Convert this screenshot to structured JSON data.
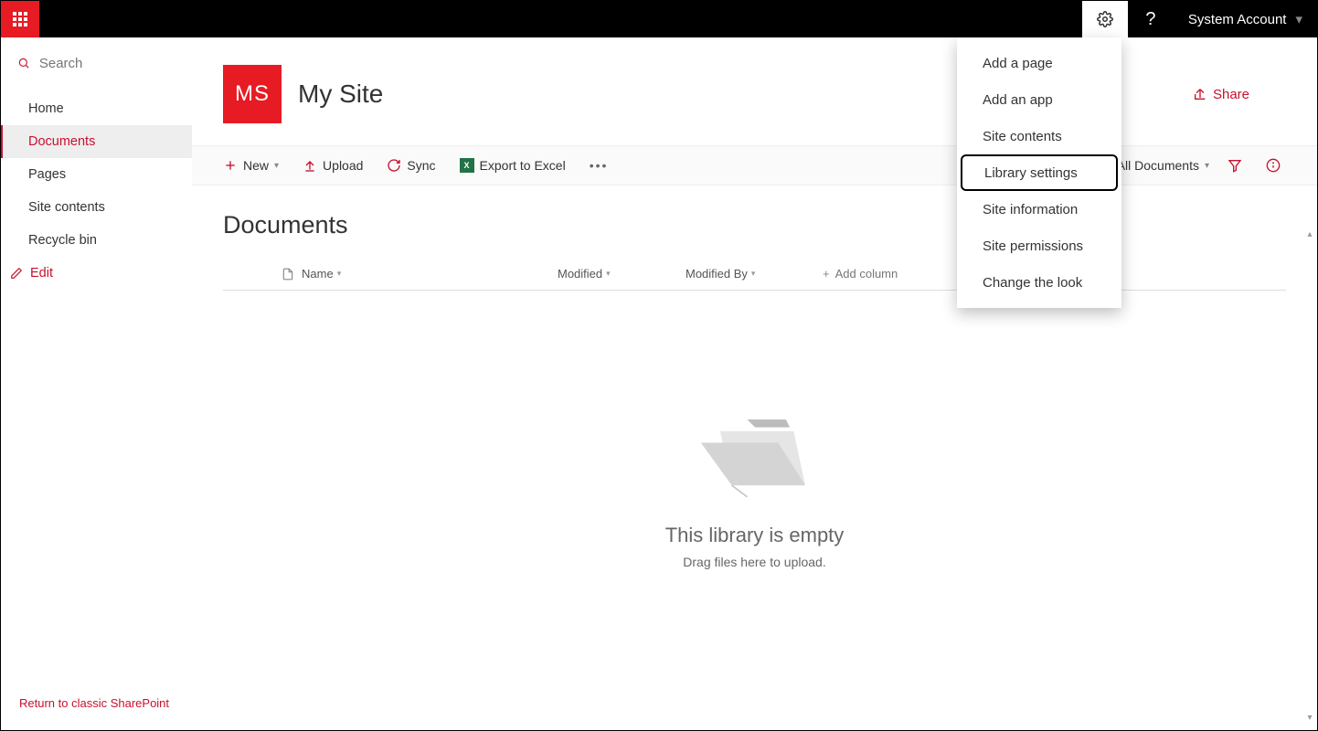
{
  "topbar": {
    "user_label": "System Account"
  },
  "sidebar": {
    "search_placeholder": "Search",
    "items": [
      {
        "label": "Home"
      },
      {
        "label": "Documents"
      },
      {
        "label": "Pages"
      },
      {
        "label": "Site contents"
      },
      {
        "label": "Recycle bin"
      }
    ],
    "edit_label": "Edit",
    "classic_link": "Return to classic SharePoint"
  },
  "site": {
    "logo_text": "MS",
    "title": "My Site",
    "share_label": "Share"
  },
  "commandbar": {
    "new_label": "New",
    "upload_label": "Upload",
    "sync_label": "Sync",
    "export_label": "Export to Excel",
    "view_label": "All Documents"
  },
  "list": {
    "title": "Documents",
    "columns": {
      "name": "Name",
      "modified": "Modified",
      "modified_by": "Modified By",
      "add_column": "Add column"
    },
    "empty_title": "This library is empty",
    "empty_subtitle": "Drag files here to upload."
  },
  "settings_menu": {
    "items": [
      "Add a page",
      "Add an app",
      "Site contents",
      "Library settings",
      "Site information",
      "Site permissions",
      "Change the look"
    ],
    "highlighted_index": 3
  }
}
